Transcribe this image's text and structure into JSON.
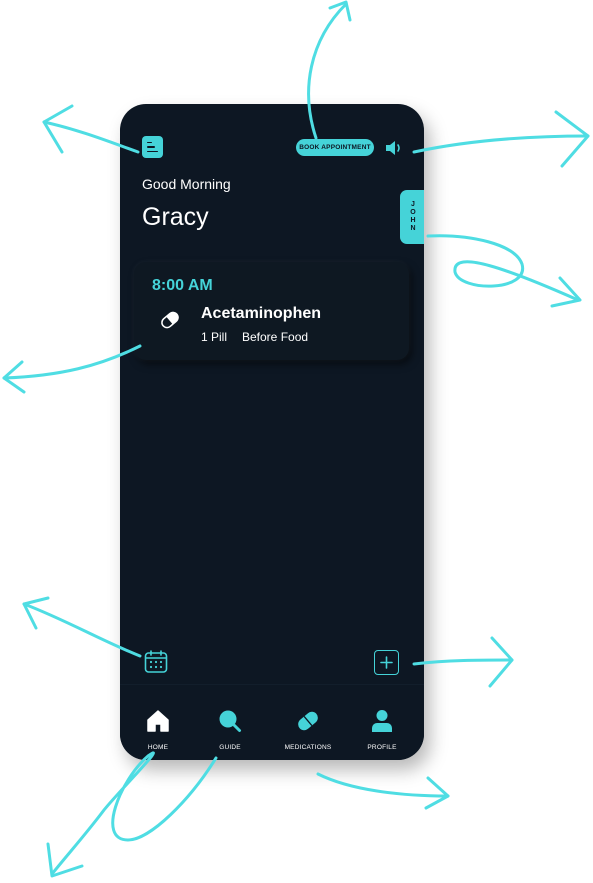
{
  "header": {
    "book_label": "BOOK APPOINTMENT",
    "menu_icon": "menu-icon",
    "speaker_icon": "speaker-icon"
  },
  "greeting": {
    "salutation": "Good Morning",
    "name": "Gracy"
  },
  "side_tab": {
    "label": "JOHN"
  },
  "medication": {
    "time": "8:00 AM",
    "name": "Acetaminophen",
    "dose": "1 Pill",
    "timing": "Before Food",
    "icon": "pill-icon"
  },
  "actions": {
    "calendar_icon": "calendar-icon",
    "add_icon": "plus-icon"
  },
  "nav": {
    "items": [
      {
        "label": "HOME",
        "icon": "home-icon",
        "active": true
      },
      {
        "label": "GUIDE",
        "icon": "search-icon",
        "active": false
      },
      {
        "label": "MEDICATIONS",
        "icon": "pill-icon",
        "active": false
      },
      {
        "label": "PROFILE",
        "icon": "user-icon",
        "active": false
      }
    ]
  },
  "colors": {
    "accent": "#45d3d8",
    "background": "#0d1723",
    "annotation": "#4fdde3",
    "text": "#ffffff"
  }
}
